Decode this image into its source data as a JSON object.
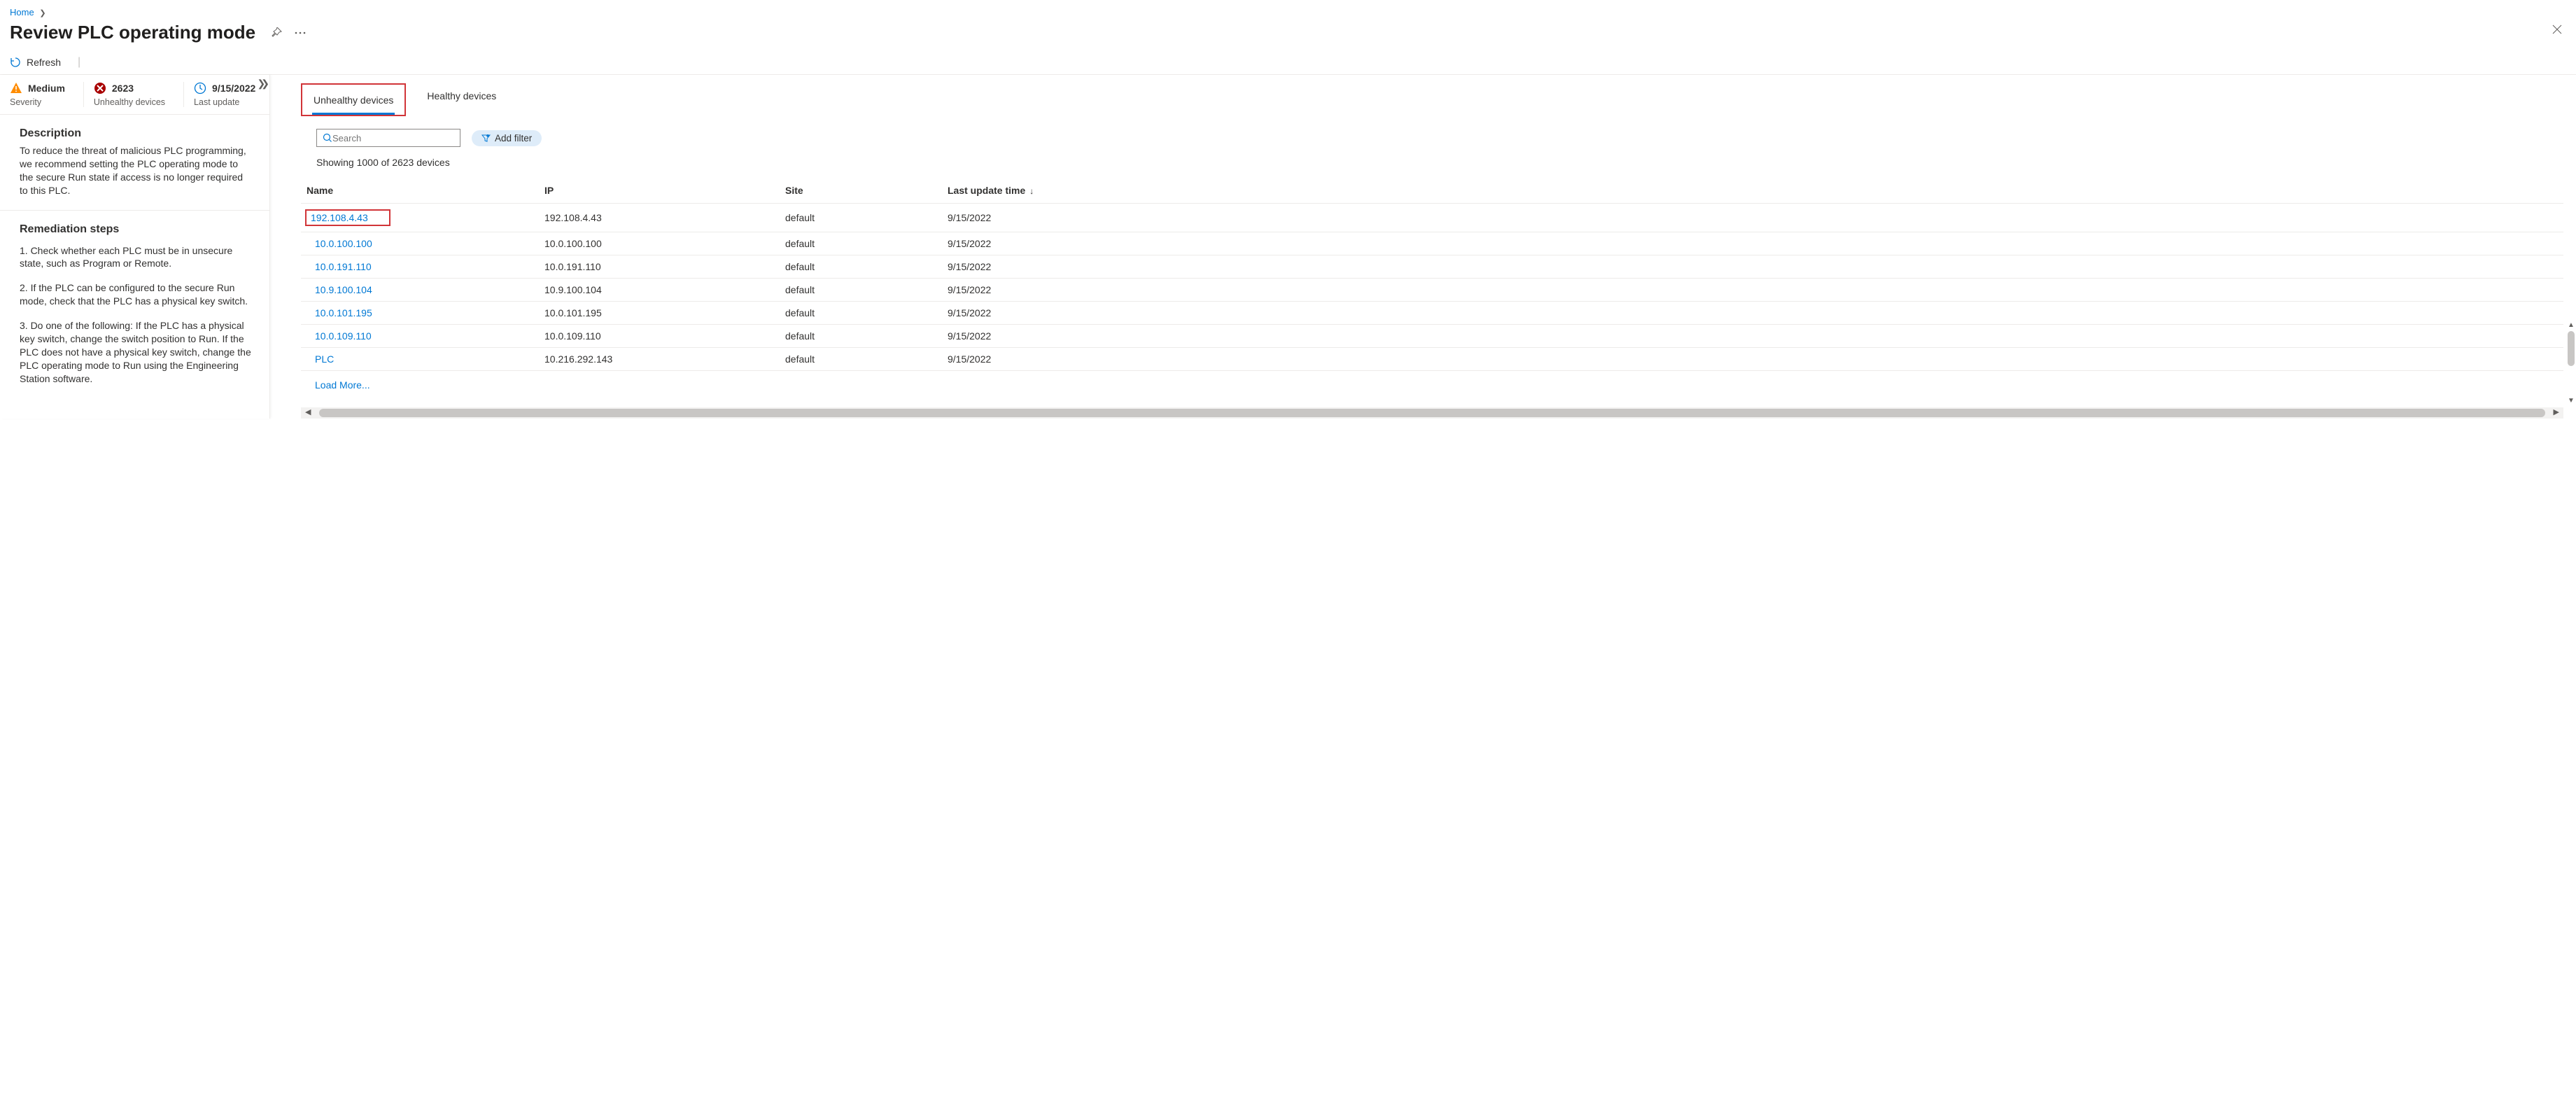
{
  "breadcrumb": {
    "home": "Home"
  },
  "page": {
    "title": "Review PLC operating mode",
    "refresh_label": "Refresh"
  },
  "stats": {
    "severity_value": "Medium",
    "severity_label": "Severity",
    "unhealthy_value": "2623",
    "unhealthy_label": "Unhealthy devices",
    "lastupdate_value": "9/15/2022",
    "lastupdate_label": "Last update"
  },
  "description": {
    "heading": "Description",
    "text": "To reduce the threat of malicious PLC programming, we recommend setting the PLC operating mode to the secure Run state if access is no longer required to this PLC."
  },
  "remediation": {
    "heading": "Remediation steps",
    "steps": [
      "1. Check whether each PLC must be in unsecure state, such as Program or Remote.",
      "2. If the PLC can be configured to the secure Run mode, check that the PLC has a physical key switch.",
      "3. Do one of the following: If the PLC has a physical key switch, change the switch position to Run. If the PLC does not have a physical key switch, change the PLC operating mode to Run using the Engineering Station software."
    ]
  },
  "tabs": {
    "unhealthy": "Unhealthy devices",
    "healthy": "Healthy devices"
  },
  "search": {
    "placeholder": "Search",
    "add_filter": "Add filter"
  },
  "count_text": "Showing 1000 of 2623 devices",
  "columns": {
    "name": "Name",
    "ip": "IP",
    "site": "Site",
    "last_update": "Last update time"
  },
  "rows": [
    {
      "name": "192.108.4.43",
      "ip": "192.108.4.43",
      "site": "default",
      "last_update": "9/15/2022",
      "highlight": true
    },
    {
      "name": "10.0.100.100",
      "ip": "10.0.100.100",
      "site": "default",
      "last_update": "9/15/2022"
    },
    {
      "name": "10.0.191.110",
      "ip": "10.0.191.110",
      "site": "default",
      "last_update": "9/15/2022"
    },
    {
      "name": "10.9.100.104",
      "ip": "10.9.100.104",
      "site": "default",
      "last_update": "9/15/2022"
    },
    {
      "name": "10.0.101.195",
      "ip": "10.0.101.195",
      "site": "default",
      "last_update": "9/15/2022"
    },
    {
      "name": "10.0.109.110",
      "ip": "10.0.109.110",
      "site": "default",
      "last_update": "9/15/2022"
    },
    {
      "name": "PLC",
      "ip": "10.216.292.143",
      "site": "default",
      "last_update": "9/15/2022"
    }
  ],
  "load_more": "Load More..."
}
